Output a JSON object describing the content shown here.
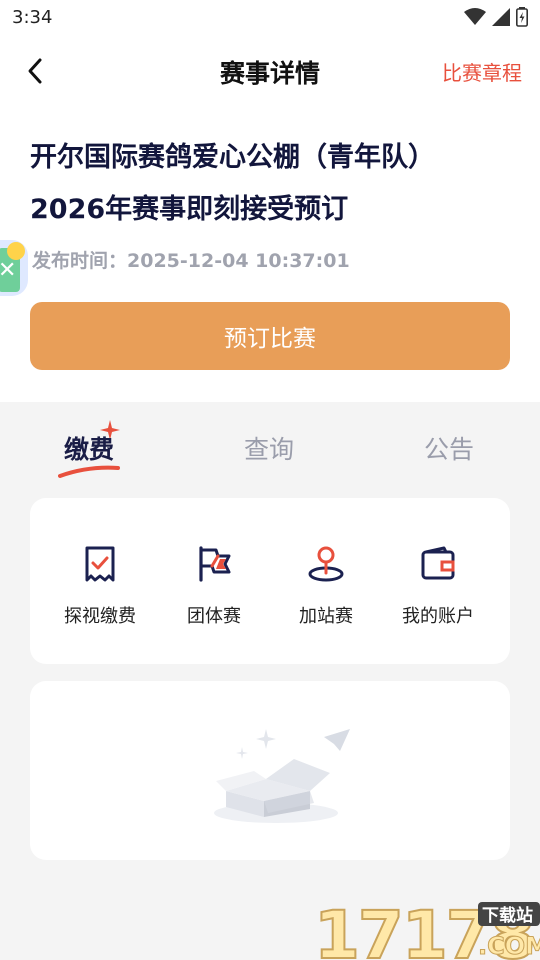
{
  "status": {
    "time": "3:34"
  },
  "nav": {
    "title": "赛事详情",
    "rules_link": "比赛章程"
  },
  "event": {
    "title_line1": "开尔国际赛鸽爱心公棚（青年队）",
    "title_line2": "2026年赛事即刻接受预订",
    "publish_label": "发布时间：",
    "publish_time": "2025-12-04 10:37:01"
  },
  "reserve_button": "预订比赛",
  "tabs": [
    {
      "label": "缴费",
      "active": true
    },
    {
      "label": "查询",
      "active": false
    },
    {
      "label": "公告",
      "active": false
    }
  ],
  "functions": [
    {
      "label": "探视缴费",
      "icon": "receipt-check-icon"
    },
    {
      "label": "团体赛",
      "icon": "flag-icon"
    },
    {
      "label": "加站赛",
      "icon": "location-pin-icon"
    },
    {
      "label": "我的账户",
      "icon": "wallet-icon"
    }
  ],
  "colors": {
    "accent": "#e89e58",
    "link": "#e8503d",
    "title": "#12163c",
    "icon_primary": "#1b2150",
    "icon_accent": "#e8503d"
  },
  "watermark": {
    "site": "17178",
    "suffix": ".COM",
    "tag": "下载站"
  }
}
